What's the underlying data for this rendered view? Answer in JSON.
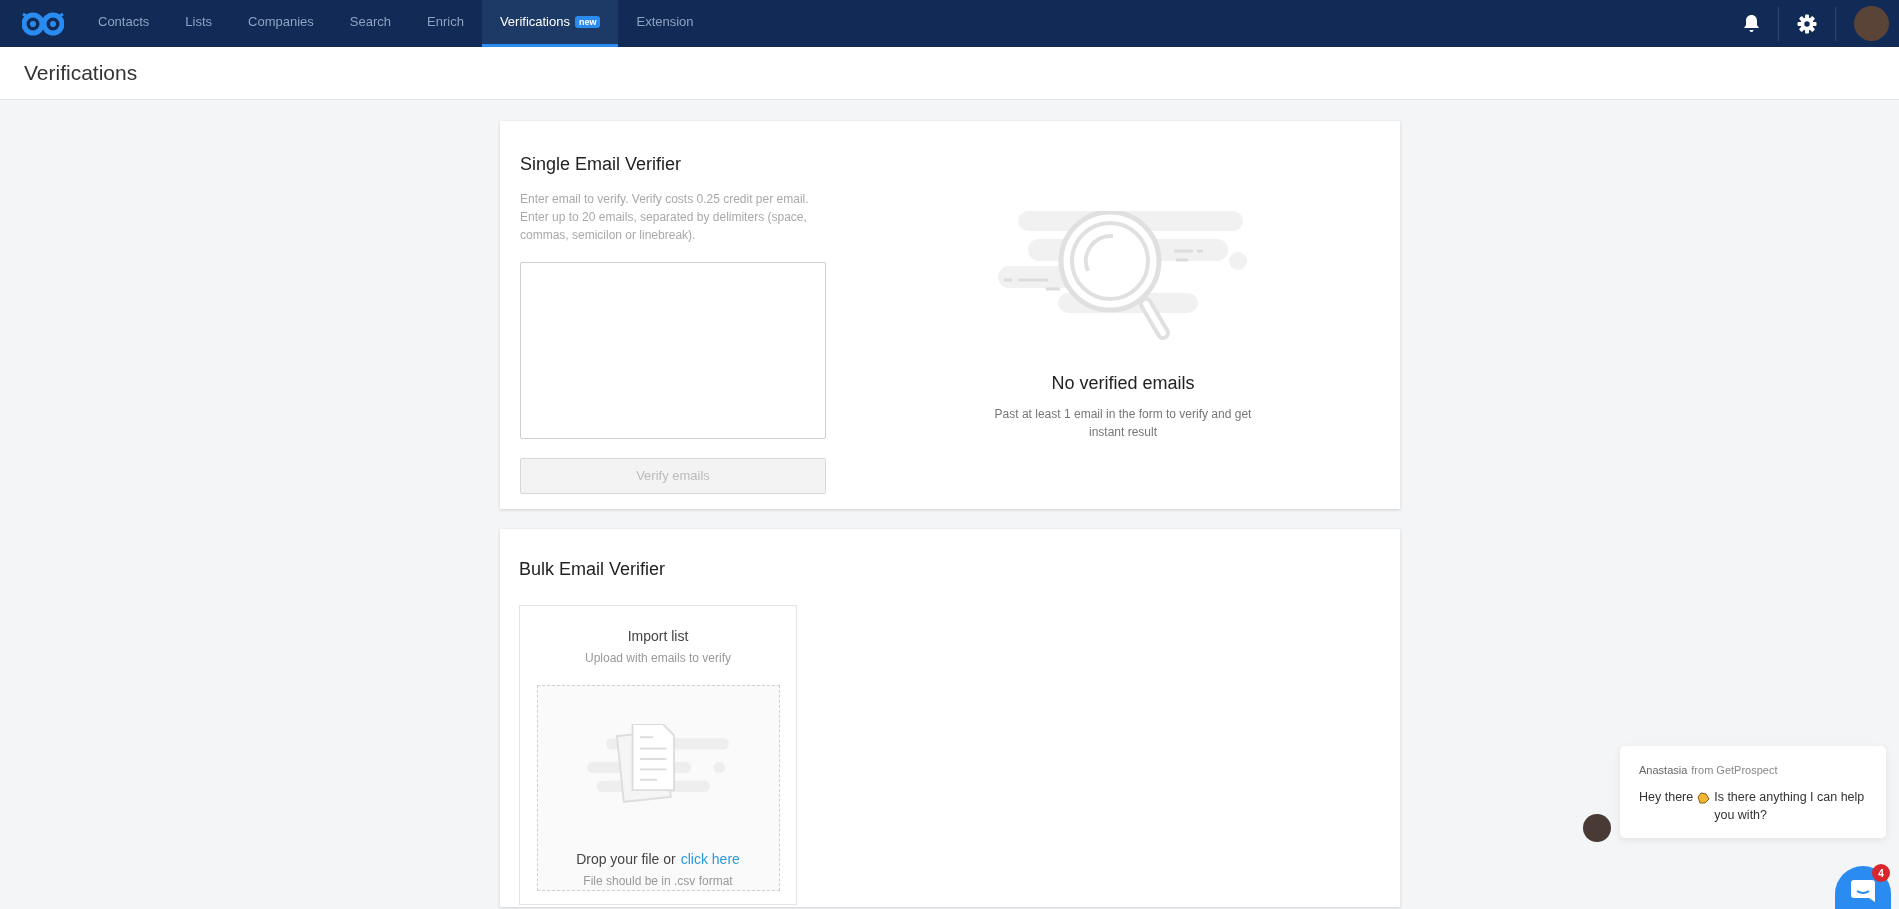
{
  "nav": {
    "tabs": [
      {
        "label": "Contacts",
        "selected": false
      },
      {
        "label": "Lists",
        "selected": false
      },
      {
        "label": "Companies",
        "selected": false
      },
      {
        "label": "Search",
        "selected": false
      },
      {
        "label": "Enrich",
        "selected": false
      },
      {
        "label": "Verifications",
        "selected": true,
        "badge": "new"
      },
      {
        "label": "Extension",
        "selected": false
      }
    ]
  },
  "page_title": "Verifications",
  "single_verifier": {
    "title": "Single Email Verifier",
    "description": "Enter email to verify. Verify costs 0.25 credit per email. Enter up to 20 emails, separated by delimiters (space, commas, semicilon or linebreak).",
    "button": {
      "label": "Verify emails",
      "disabled": true
    },
    "empty_title": "No verified emails",
    "empty_text": "Past at least 1 email in the form to verify and get instant result"
  },
  "bulk_verifier": {
    "title": "Bulk Email Verifier",
    "import_title": "Import list",
    "import_subtitle": "Upload with emails to verify",
    "drop_text": "Drop your file or",
    "drop_link": "click here",
    "drop_hint": "File should be in .csv format"
  },
  "chat": {
    "sender": "Anastasia",
    "sender_suffix": "from GetProspect",
    "message_start": "Hey there",
    "message_end": "Is there anything I can help you with?",
    "unread": "4"
  }
}
